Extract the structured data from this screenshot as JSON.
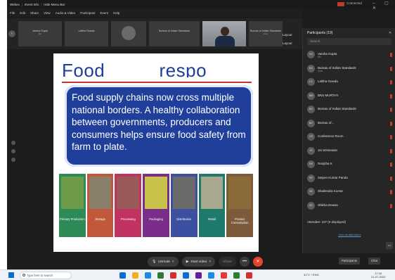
{
  "window": {
    "title_items": [
      "Webex",
      "Event info",
      "Hide Menu Bar"
    ],
    "connection": "Connected",
    "win_controls": "– ▢ ✕"
  },
  "menu": [
    "File",
    "Edit",
    "Share",
    "View",
    "Audio & Video",
    "Participant",
    "Event",
    "Help"
  ],
  "thumbnails": [
    {
      "name": "Varsha Gupta",
      "sub": "Me"
    },
    {
      "name": "Lalitha Gowda",
      "sub": ""
    },
    {
      "name": "Bureau of Indian Standards",
      "sub": ""
    },
    {
      "name": "Bureau of Indian Standards",
      "sub": "Host"
    }
  ],
  "side_labels": [
    "Layout",
    "Layout"
  ],
  "slide": {
    "title": "Food          respo",
    "callout": "Food supply chains now cross multiple national borders. A healthy collaboration between governments, producers and consumers helps ensure food safety from farm to plate.",
    "tiles": [
      {
        "label": "Primary Production",
        "color": "#2e8b57",
        "pic": "#6f9a4a"
      },
      {
        "label": "Storage",
        "color": "#c1573b",
        "pic": "#8a7f6a"
      },
      {
        "label": "Processing",
        "color": "#c0325f",
        "pic": "#9a5a5a"
      },
      {
        "label": "Packaging",
        "color": "#7a2e8a",
        "pic": "#c9c24a"
      },
      {
        "label": "Distribution",
        "color": "#3c4fa0",
        "pic": "#6b6b6b"
      },
      {
        "label": "Retail",
        "color": "#1e7a6a",
        "pic": "#a8a890"
      },
      {
        "label": "Product Consumption",
        "color": "#7d5a3a",
        "pic": "#8b6a3a"
      }
    ]
  },
  "controls": {
    "unmute": "Unmute",
    "start_video": "Start video",
    "share": "Share",
    "more": "•••",
    "end": "✕"
  },
  "participants": {
    "header": "Participants (19)",
    "close": "✕",
    "search_placeholder": "Search",
    "list": [
      {
        "initials": "VG",
        "name": "Varsha Gupta",
        "sub": "Me"
      },
      {
        "initials": "BS",
        "name": "Bureau of Indian Standards",
        "sub": "Host"
      },
      {
        "initials": "LG",
        "name": "Lalitha Gowda",
        "sub": ""
      },
      {
        "initials": "BM",
        "name": "BNS MURTHY",
        "sub": ""
      },
      {
        "initials": "BS",
        "name": "Bureau of Indian Standards",
        "sub": ""
      },
      {
        "initials": "BO",
        "name": "Bureau of...",
        "sub": ""
      },
      {
        "initials": "CR",
        "name": "Conference Room",
        "sub": ""
      },
      {
        "initials": "JS",
        "name": "Jai Srinivasan",
        "sub": ""
      },
      {
        "initials": "RK",
        "name": "Ranjitha K",
        "sub": ""
      },
      {
        "initials": "SP",
        "name": "Satyen Kumar Panda",
        "sub": ""
      },
      {
        "initials": "SK",
        "name": "Shailendra Kumar",
        "sub": ""
      },
      {
        "initials": "SD",
        "name": "Shikha Dewan",
        "sub": ""
      }
    ],
    "attendee_label": "Attendee: 107 (0 displayed)",
    "view_all": "View all attendees"
  },
  "panel_bottom": {
    "participants_btn": "Participants",
    "chat_btn": "Chat"
  },
  "taskbar": {
    "search_placeholder": "Type here to search",
    "tray": "31°C  ^  ENG",
    "time": "17:16",
    "date": "21-07-2022",
    "apps": [
      "#0a6ed1",
      "#f2b01e",
      "#1e88e5",
      "#2e7d32",
      "#d32f2f",
      "#0a6ed1",
      "#6a1b9a",
      "#1e88e5",
      "#e53935",
      "#2e7d32",
      "#d32f2f"
    ]
  }
}
